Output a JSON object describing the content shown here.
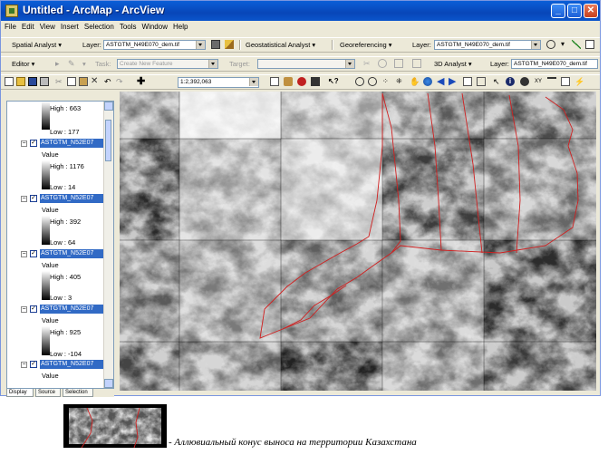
{
  "window": {
    "title": "Untitled - ArcMap - ArcView",
    "controls": {
      "minimize": "_",
      "maximize": "□",
      "close": "✕"
    }
  },
  "menu": [
    "File",
    "Edit",
    "View",
    "Insert",
    "Selection",
    "Tools",
    "Window",
    "Help"
  ],
  "toolbar1": {
    "spatial_analyst": "Spatial Analyst ▾",
    "layer_label": "Layer:",
    "layer_value": "ASTGTM_N49E070_dem.tif",
    "geostatistical": "Geostatistical Analyst ▾",
    "georeferencing": "Georeferencing ▾",
    "layer2_label": "Layer:",
    "layer2_value": "ASTGTM_N49E070_dem.tif"
  },
  "toolbar2": {
    "editor": "Editor ▾",
    "task_label": "Task:",
    "task_value": "Create New Feature",
    "target_label": "Target:",
    "target_value": "",
    "analyst3d": "3D Analyst ▾",
    "layer3_label": "Layer:",
    "layer3_value": "ASTGTM_N49E070_dem.tif"
  },
  "toolbar3": {
    "scale": "1:2,392,063"
  },
  "toc": {
    "entries": [
      {
        "high": "High : 663",
        "low": "Low : 177"
      },
      {
        "name": "ASTGTM_N52E07",
        "value": "Value",
        "high": "High : 1176",
        "low": "Low : 14"
      },
      {
        "name": "ASTGTM_N52E07",
        "value": "Value",
        "high": "High : 392",
        "low": "Low : 64"
      },
      {
        "name": "ASTGTM_N52E07",
        "value": "Value",
        "high": "High : 405",
        "low": "Low : 3"
      },
      {
        "name": "ASTGTM_N52E07",
        "value": "Value",
        "high": "High : 925",
        "low": "Low : -104"
      },
      {
        "name": "ASTGTM_N52E07",
        "value": "Value"
      }
    ],
    "tabs": [
      "Display",
      "Source",
      "Selection"
    ]
  },
  "caption": "- Аллювиальный конус выноса на территории Казахстана",
  "colors": {
    "title_bar": "#0a5fd8",
    "boundary": "#d02020",
    "selection": "#316ac5"
  }
}
